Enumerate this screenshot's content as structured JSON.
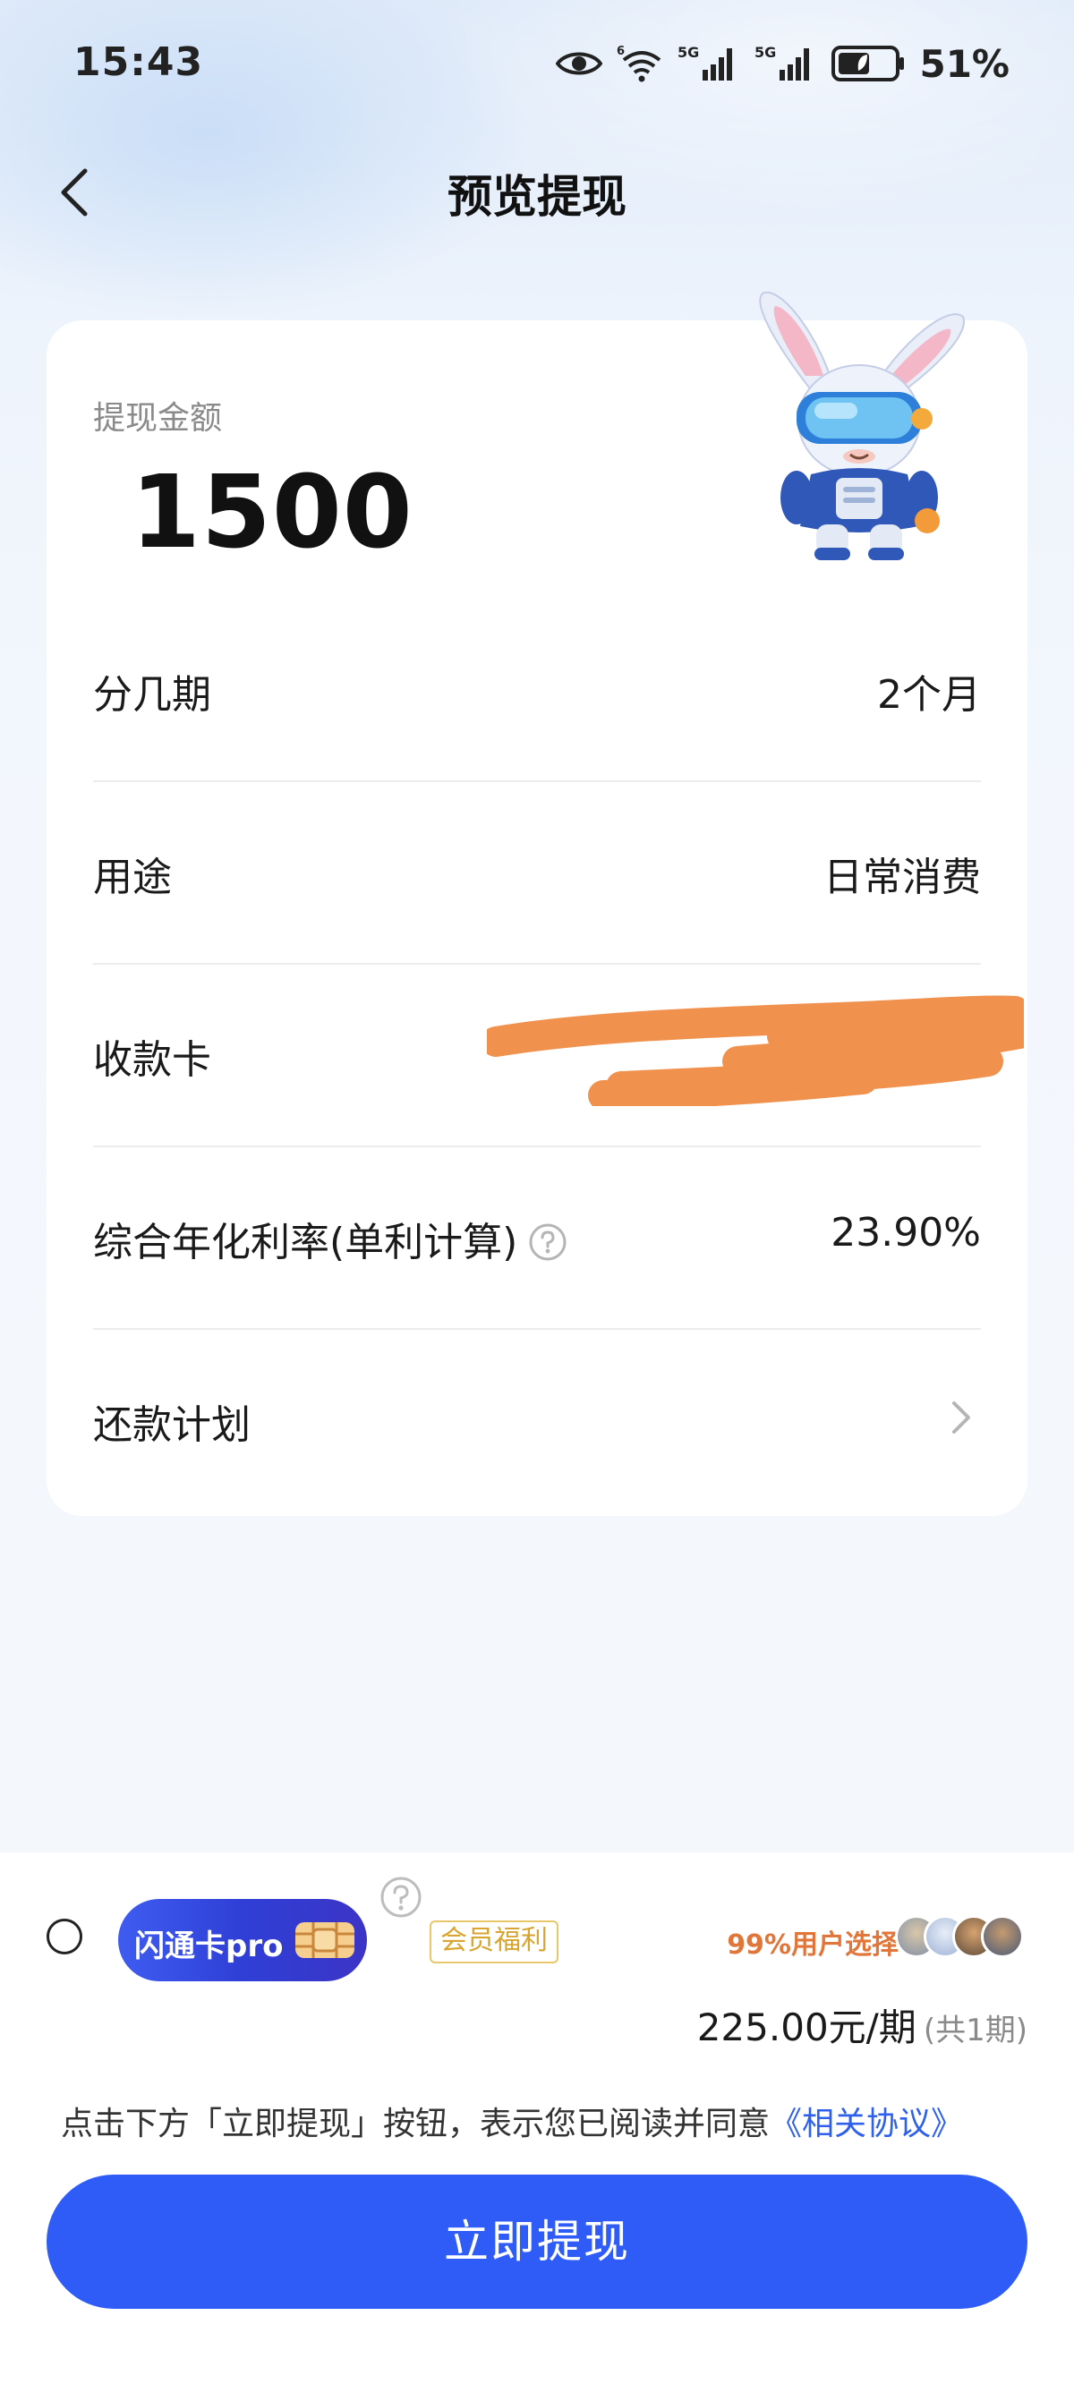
{
  "status_bar": {
    "time": "15:43",
    "net1": "5G",
    "net2": "5G",
    "battery": "51%"
  },
  "header": {
    "title": "预览提现"
  },
  "card": {
    "amount_label": "提现金额",
    "amount": "1500",
    "rows": [
      {
        "label": "分几期",
        "value": "2个月"
      },
      {
        "label": "用途",
        "value": "日常消费"
      },
      {
        "label": "收款卡",
        "value": ""
      },
      {
        "label": "综合年化利率(单利计算)",
        "value": "23.90%"
      },
      {
        "label": "还款计划",
        "value": ""
      }
    ]
  },
  "membership": {
    "badge": "闪通卡pro",
    "tag": "会员福利",
    "user_choice": "99%用户选择",
    "price": "225.00元/期",
    "periods": "(共1期)",
    "checked": false
  },
  "agreement": {
    "text": "点击下方「立即提现」按钮，表示您已阅读并同意",
    "link": "《相关协议》"
  },
  "submit": {
    "label": "立即提现"
  },
  "colors": {
    "primary": "#2f5cf6",
    "link": "#2f60ec",
    "member_gold": "#d9a531",
    "highlight_orange": "#e0763a",
    "redaction": "#f0924d"
  }
}
